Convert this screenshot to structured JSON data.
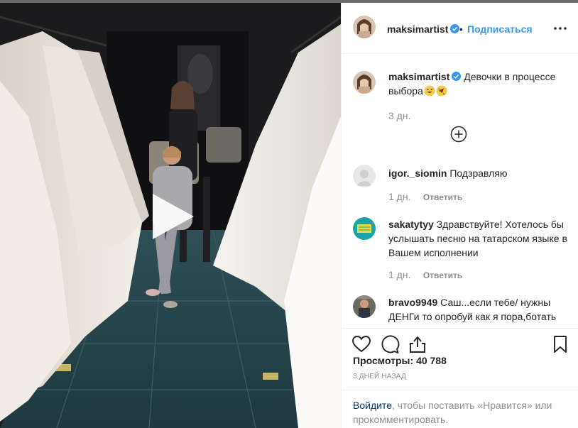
{
  "post": {
    "author": "maksimartist",
    "follow_label": "Подписаться",
    "dot": "•",
    "caption_text": "Девочки в процессе выбора",
    "caption_time": "3 дн.",
    "views_label": "Просмотры:",
    "views_count": "40 788",
    "date": "3 дней назад"
  },
  "comments": [
    {
      "user": "igor._siomin",
      "text": "Подзравляю",
      "time": "1 дн.",
      "reply_label": "Ответить"
    },
    {
      "user": "sakatytyy",
      "text": "Здравствуйте! Хотелось бы услышать песню на татарском языке в Вашем исполнении",
      "time": "1 дн.",
      "reply_label": "Ответить"
    },
    {
      "user": "bravo9949",
      "text": "Саш...если тебе/ нужны ДЕНГи то опробуй как я пора,ботать"
    }
  ],
  "footer": {
    "login_link": "Войдите",
    "login_text": ", чтобы поставить «Нравится» или прокомментировать."
  },
  "colors": {
    "accent": "#3897f0",
    "verified": "#3897f0",
    "muted": "#8e8e8e",
    "text": "#262626"
  },
  "icons": {
    "more": "more-options-icon",
    "load_more": "plus-circle-icon",
    "like": "heart-icon",
    "comment": "comment-icon",
    "share": "share-icon",
    "save": "bookmark-icon",
    "play": "play-icon"
  }
}
